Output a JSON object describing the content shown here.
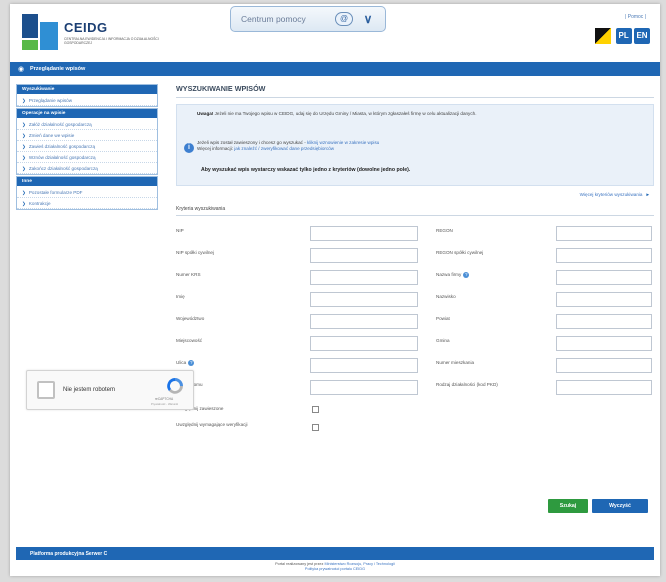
{
  "header": {
    "logo_name": "CEIDG",
    "logo_sub": "CENTRALNA EWIDENCJA I INFORMACJA O DZIAŁALNOŚCI GOSPODARCZEJ",
    "help_label": "Centrum pomocy",
    "help_icon_text": "@",
    "top_link": "| Pomoc |",
    "lang_pl": "PL",
    "lang_en": "EN"
  },
  "title_bar": {
    "text": "Przeglądanie wpisów"
  },
  "sidebar": {
    "sections": [
      {
        "title": "Wyszukiwanie",
        "items": [
          "Przeglądanie wpisów"
        ]
      },
      {
        "title": "Operacje na wpisie",
        "items": [
          "Załóż działalność gospodarczą",
          "Zmień dane we wpisie",
          "Zawieś działalność gospodarczą",
          "Wznów działalność gospodarczą",
          "Zakończ działalność gospodarczą"
        ]
      },
      {
        "title": "Inne",
        "items": [
          "Pozostałe formularze PDF",
          "Kontrakcje"
        ]
      }
    ]
  },
  "main": {
    "title": "WYSZUKIWANIE WPISÓW",
    "notice_bold": "Uwaga!",
    "notice_text": " Jeżeli nie ma Twojego wpisu w CEIDG, udaj się do Urzędu Gminy / Miasta, w którym zgłaszałeś firmę w celu aktualizacji danych.",
    "notice_line2a": "Jeżeli wpis został zawieszony i chcesz go wyszukać - ",
    "notice_line2a_link": "kliknij wznowienie w zakresie wpisu",
    "notice_line2b": "Więcej informacji: ",
    "notice_line2b_link": "jak znaleźć / zweryfikować dane przedsiębiorców",
    "notice_line3": "Aby wyszukać wpis wystarczy wskazać tylko jedno z kryteriów (dowolne jedno pole).",
    "adv_link": "Więcej kryteriów wyszukiwania",
    "criteria_title": "Kryteria wyszukiwania",
    "left_labels": [
      "NIP",
      "NIP spółki cywilnej",
      "Numer KRS",
      "Imię",
      "Województwo",
      "Miejscowość",
      "Ulica",
      "Numer domu"
    ],
    "right_labels": [
      "REGON",
      "REGON spółki cywilnej",
      "Nazwa firmy",
      "Nazwisko",
      "Powiat",
      "Gmina",
      "Numer mieszkania",
      "Rodzaj działalności (kod PKD)"
    ],
    "checkbox1": "Uwzględnij zawieszone",
    "checkbox2": "Uwzględnij wymagające weryfikacji",
    "captcha_text": "Nie jestem robotem",
    "captcha_name": "reCAPTCHA",
    "captcha_terms": "Prywatność - Warunki",
    "search_button": "Szukaj",
    "clear_button": "Wyczyść"
  },
  "footer": {
    "bar_text": "Platforma produkcyjna Serwer C",
    "line1": "Portal realizowany jest przez ",
    "line1_link": "Ministerstwo Rozwoju, Pracy i Technologii",
    "line2": "Polityka prywatności portalu CEIDG"
  },
  "colors": {
    "accent": "#1f67b4",
    "search_button": "#2e9a3f"
  }
}
